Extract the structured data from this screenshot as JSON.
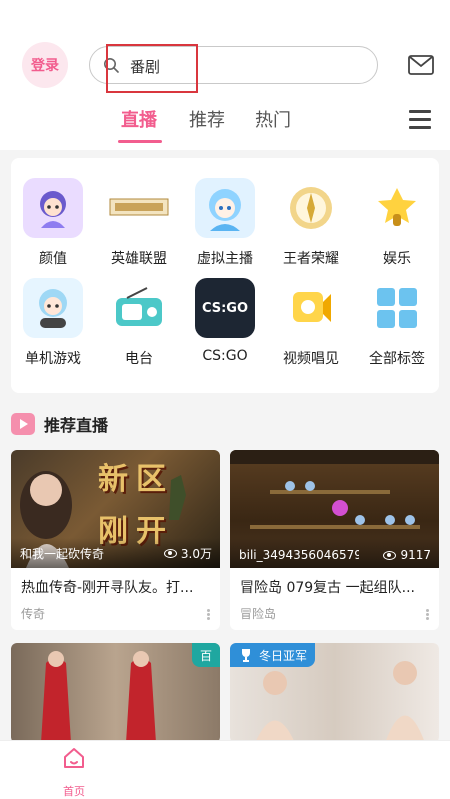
{
  "header": {
    "login_label": "登录",
    "search_value": "番剧",
    "accent_color": "#f25d8e"
  },
  "tabs": [
    {
      "label": "直播",
      "active": true
    },
    {
      "label": "推荐",
      "active": false
    },
    {
      "label": "热门",
      "active": false
    }
  ],
  "categories": [
    {
      "label": "颜值",
      "icon": "anime-girl-icon"
    },
    {
      "label": "英雄联盟",
      "icon": "league-of-legends-logo"
    },
    {
      "label": "虚拟主播",
      "icon": "vtuber-icon"
    },
    {
      "label": "王者荣耀",
      "icon": "honor-of-kings-icon"
    },
    {
      "label": "娱乐",
      "icon": "microphone-star-icon"
    },
    {
      "label": "单机游戏",
      "icon": "gamer-girl-icon"
    },
    {
      "label": "电台",
      "icon": "radio-icon"
    },
    {
      "label": "CS:GO",
      "icon": "csgo-logo",
      "logo_text": "CS:GO"
    },
    {
      "label": "视频唱见",
      "icon": "singing-icon"
    },
    {
      "label": "全部标签",
      "icon": "grid-tags-icon"
    }
  ],
  "section": {
    "title": "推荐直播"
  },
  "live_cards": [
    {
      "streamer": "和我一起砍传奇",
      "viewers": "3.0万",
      "title": "热血传奇-刚开寻队友。打...",
      "category": "传奇",
      "thumb_text": "新区刚开"
    },
    {
      "streamer": "bili_3494356046579...",
      "viewers": "9117",
      "title": "冒险岛 079复古 一起组队...",
      "category": "冒险岛"
    },
    {
      "badge": "百",
      "badge_color": "#1fa7a0"
    },
    {
      "badge": "冬日亚军",
      "badge_color": "#2f8fd8"
    }
  ],
  "bottom_nav": {
    "home_label": "首页"
  }
}
